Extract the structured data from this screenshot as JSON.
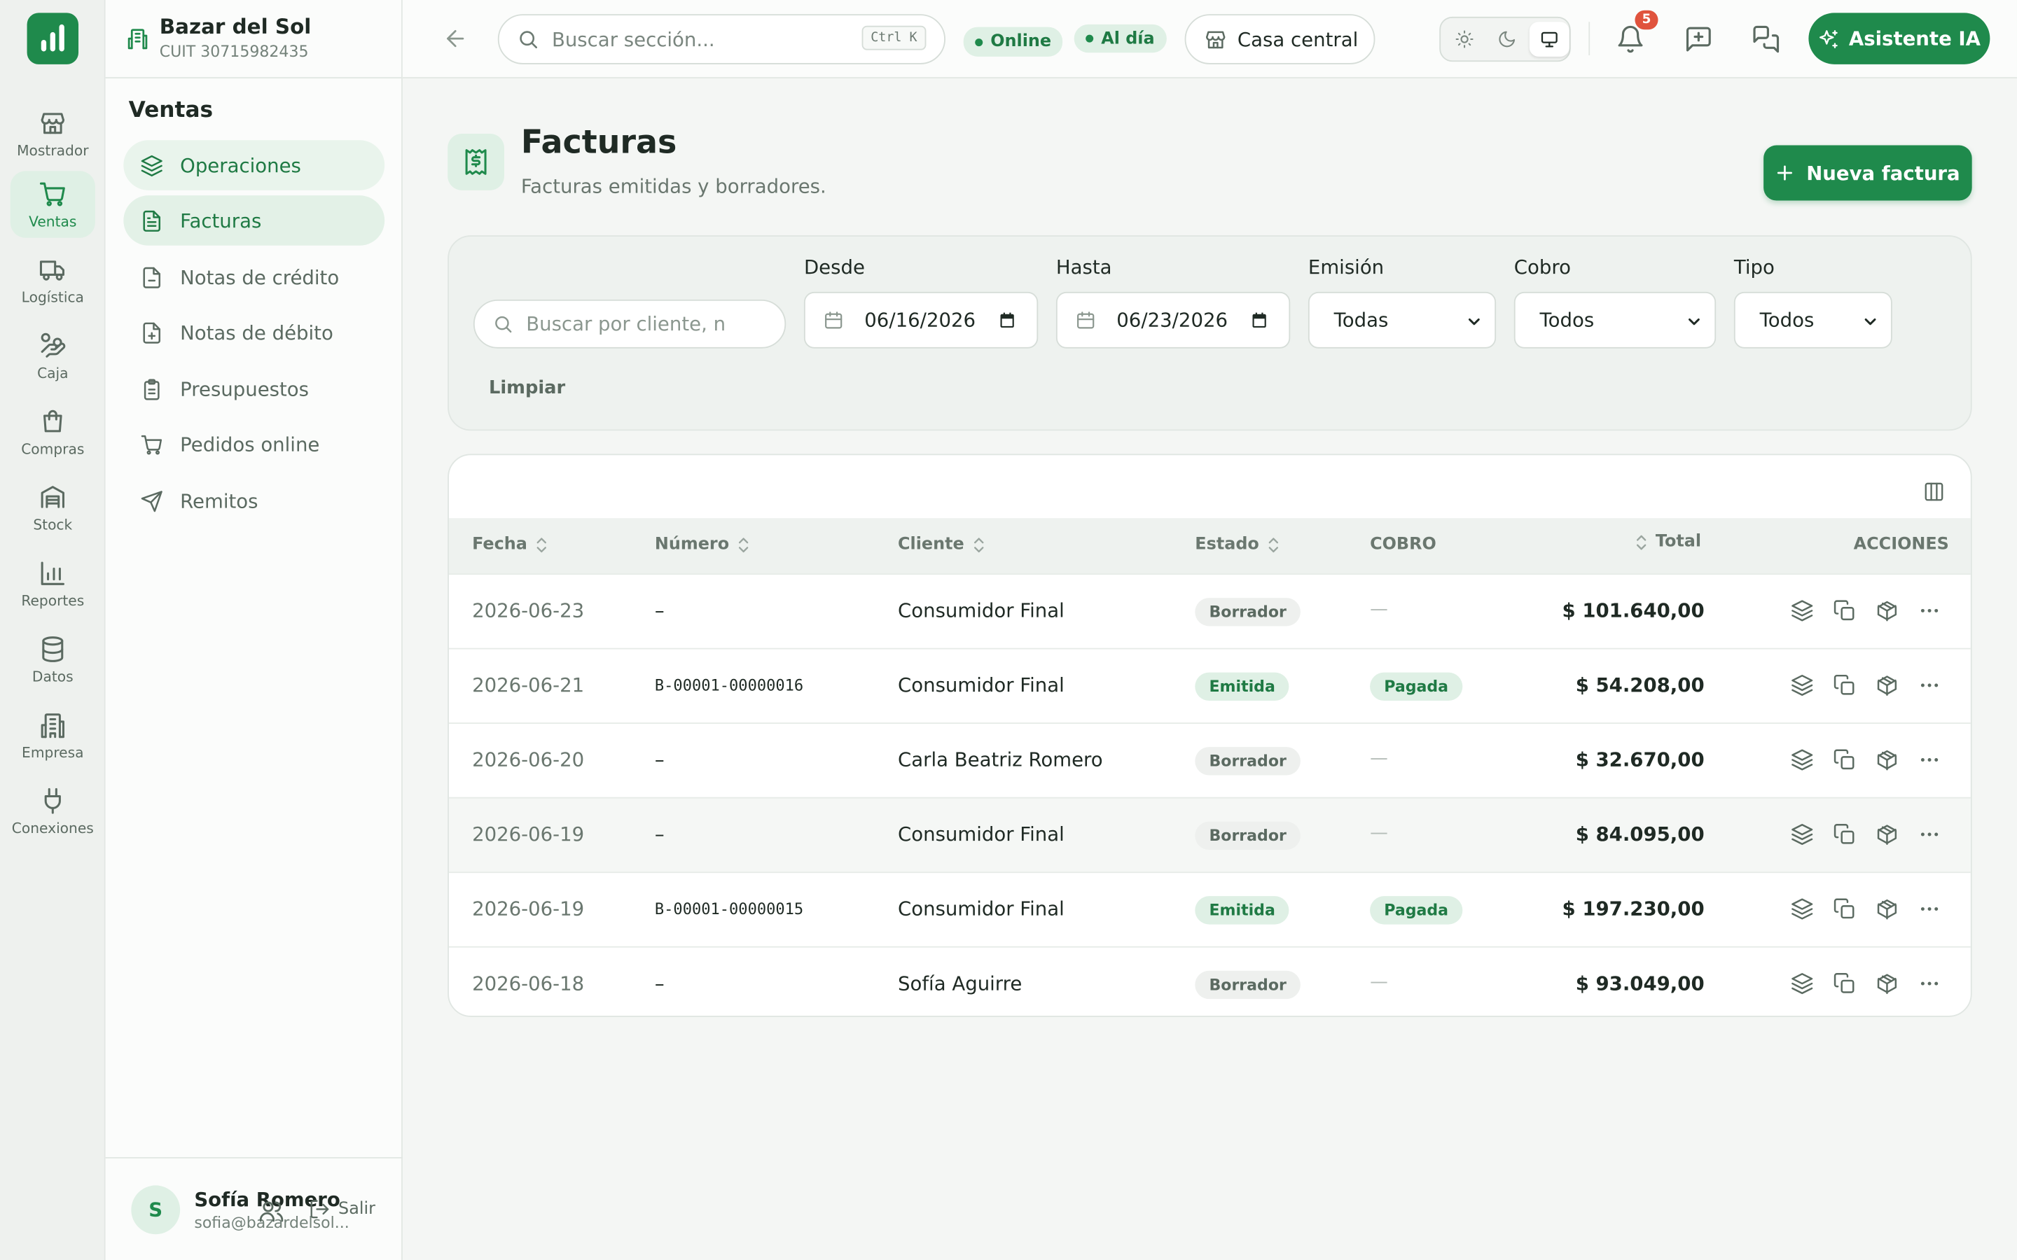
{
  "brand": {
    "name": "Bazar del Sol",
    "cuit": "CUIT 30715982435"
  },
  "rail": [
    {
      "label": "Mostrador",
      "icon": "store-icon"
    },
    {
      "label": "Ventas",
      "icon": "cart-icon",
      "active": true
    },
    {
      "label": "Logística",
      "icon": "truck-icon"
    },
    {
      "label": "Caja",
      "icon": "hand-coins-icon"
    },
    {
      "label": "Compras",
      "icon": "bag-icon"
    },
    {
      "label": "Stock",
      "icon": "warehouse-icon"
    },
    {
      "label": "Reportes",
      "icon": "bar-chart-icon"
    },
    {
      "label": "Datos",
      "icon": "database-icon"
    },
    {
      "label": "Empresa",
      "icon": "building-icon"
    },
    {
      "label": "Conexiones",
      "icon": "plug-icon"
    }
  ],
  "side": {
    "title": "Ventas",
    "items": [
      {
        "label": "Operaciones",
        "icon": "layers-icon"
      },
      {
        "label": "Facturas",
        "icon": "file-text-icon",
        "active": true
      },
      {
        "label": "Notas de crédito",
        "icon": "file-minus-icon"
      },
      {
        "label": "Notas de débito",
        "icon": "file-plus-icon"
      },
      {
        "label": "Presupuestos",
        "icon": "clipboard-icon"
      },
      {
        "label": "Pedidos online",
        "icon": "cart-icon"
      },
      {
        "label": "Remitos",
        "icon": "send-icon"
      }
    ]
  },
  "user": {
    "initial": "S",
    "name": "Sofía Romero",
    "email": "sofia@bazardelsol...",
    "logout": "Salir"
  },
  "topbar": {
    "search_placeholder": "Buscar sección...",
    "shortcut": "Ctrl K",
    "online": "Online",
    "synced": "Al día",
    "store": "Casa central",
    "notifications": "5",
    "ai_button": "Asistente IA"
  },
  "page": {
    "title": "Facturas",
    "subtitle": "Facturas emitidas y borradores.",
    "new_button": "Nueva factura"
  },
  "filters": {
    "search_placeholder": "Buscar por cliente, n",
    "from_label": "Desde",
    "from_value": "06/16/2026",
    "to_label": "Hasta",
    "to_value": "06/23/2026",
    "emission_label": "Emisión",
    "emission_value": "Todas",
    "payment_label": "Cobro",
    "payment_value": "Todos",
    "type_label": "Tipo",
    "type_value": "Todos",
    "clear": "Limpiar"
  },
  "table": {
    "headers": {
      "date": "Fecha",
      "number": "Número",
      "client": "Cliente",
      "status": "Estado",
      "payment": "COBRO",
      "total": "Total",
      "actions": "ACCIONES"
    },
    "rows": [
      {
        "date": "2026-06-23",
        "number": "–",
        "client": "Consumidor Final",
        "status": "Borrador",
        "payment": "—",
        "total": "$ 101.640,00"
      },
      {
        "date": "2026-06-21",
        "number": "B-00001-00000016",
        "client": "Consumidor Final",
        "status": "Emitida",
        "payment": "Pagada",
        "total": "$ 54.208,00"
      },
      {
        "date": "2026-06-20",
        "number": "–",
        "client": "Carla Beatriz Romero",
        "status": "Borrador",
        "payment": "—",
        "total": "$ 32.670,00"
      },
      {
        "date": "2026-06-19",
        "number": "–",
        "client": "Consumidor Final",
        "status": "Borrador",
        "payment": "—",
        "total": "$ 84.095,00"
      },
      {
        "date": "2026-06-19",
        "number": "B-00001-00000015",
        "client": "Consumidor Final",
        "status": "Emitida",
        "payment": "Pagada",
        "total": "$ 197.230,00"
      },
      {
        "date": "2026-06-18",
        "number": "–",
        "client": "Sofía Aguirre",
        "status": "Borrador",
        "payment": "—",
        "total": "$ 93.049,00"
      }
    ]
  },
  "colors": {
    "accent": "#1f8a4c",
    "accent_soft": "#dff0e5",
    "badge": "#e0533d"
  }
}
